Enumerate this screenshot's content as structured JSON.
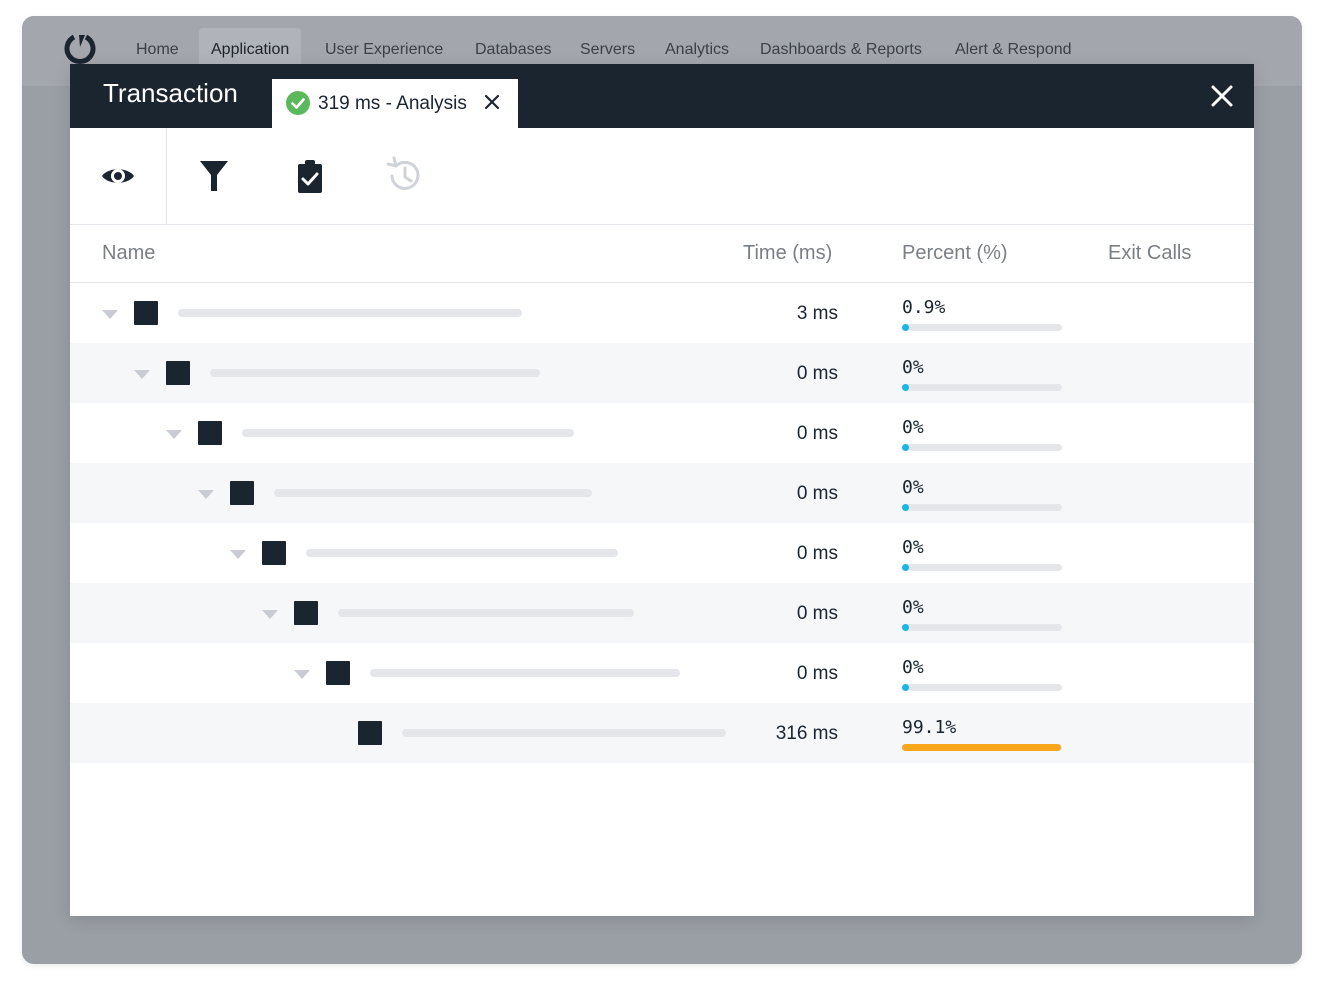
{
  "nav": {
    "items": [
      "Home",
      "Application",
      "User Experience",
      "Databases",
      "Servers",
      "Analytics",
      "Dashboards & Reports",
      "Alert & Respond"
    ],
    "active_index": 1
  },
  "modal": {
    "title": "Transaction",
    "tab_label": "319 ms - Analysis",
    "tab_status_color": "#5cb85c",
    "toolbar_icons": [
      "eye-icon",
      "filter-icon",
      "clipboard-check-icon",
      "history-icon"
    ]
  },
  "table": {
    "headers": {
      "name": "Name",
      "time": "Time (ms)",
      "percent": "Percent (%)",
      "exit_calls": "Exit Calls"
    },
    "rows": [
      {
        "depth": 0,
        "expandable": true,
        "time": "3 ms",
        "percent": "0.9%",
        "percent_value": 0.9
      },
      {
        "depth": 1,
        "expandable": true,
        "time": "0 ms",
        "percent": "0%",
        "percent_value": 0
      },
      {
        "depth": 2,
        "expandable": true,
        "time": "0 ms",
        "percent": "0%",
        "percent_value": 0
      },
      {
        "depth": 3,
        "expandable": true,
        "time": "0 ms",
        "percent": "0%",
        "percent_value": 0
      },
      {
        "depth": 4,
        "expandable": true,
        "time": "0 ms",
        "percent": "0%",
        "percent_value": 0
      },
      {
        "depth": 5,
        "expandable": true,
        "time": "0 ms",
        "percent": "0%",
        "percent_value": 0
      },
      {
        "depth": 6,
        "expandable": true,
        "time": "0 ms",
        "percent": "0%",
        "percent_value": 0
      },
      {
        "depth": 7,
        "expandable": false,
        "time": "316 ms",
        "percent": "99.1%",
        "percent_value": 99.1
      }
    ]
  },
  "colors": {
    "header_bg": "#1b2530",
    "bar_low": "#1ab7e6",
    "bar_high": "#f9a61a"
  }
}
